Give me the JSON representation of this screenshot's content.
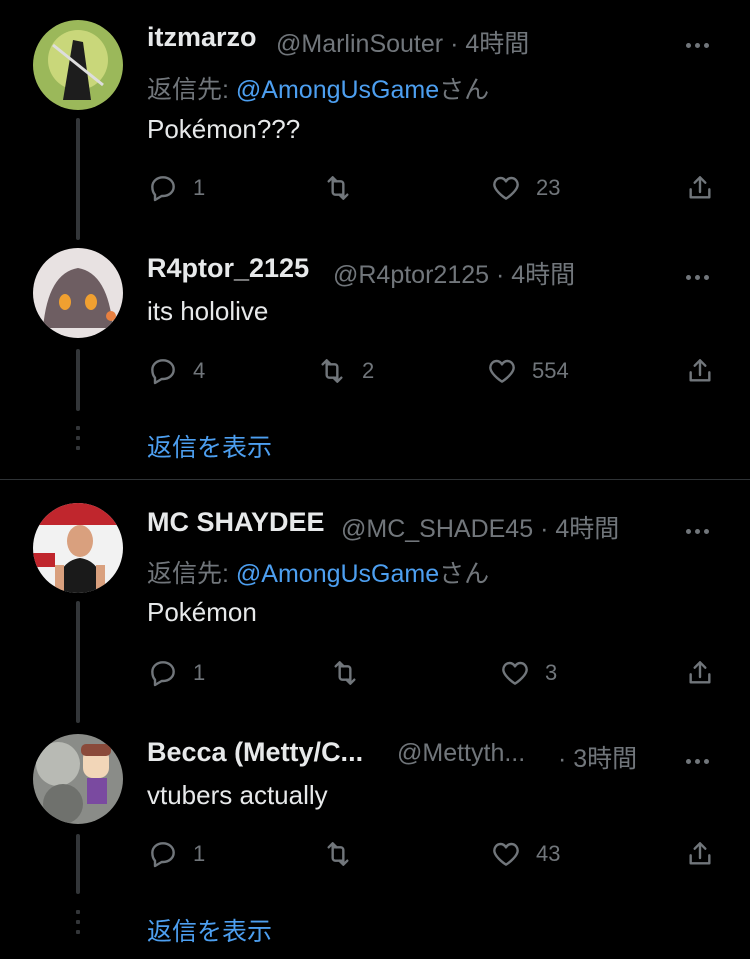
{
  "tweets": [
    {
      "name": "itzmarzo",
      "handle": "@MarlinSouter",
      "time": "· 4時間",
      "reply_prefix": "返信先: ",
      "reply_to": "@AmongUsGame",
      "reply_suffix": "さん",
      "text": "Pokémon???",
      "replies": "1",
      "retweets": "",
      "likes": "23"
    },
    {
      "name": "R4ptor_2125",
      "handle": "@R4ptor2125",
      "time": "· 4時間",
      "text": "its hololive",
      "replies": "4",
      "retweets": "2",
      "likes": "554"
    },
    {
      "name": "MC SHAYDEE",
      "handle": "@MC_SHADE45",
      "time": "· 4時間",
      "reply_prefix": "返信先: ",
      "reply_to": "@AmongUsGame",
      "reply_suffix": "さん",
      "text": "Pokémon",
      "replies": "1",
      "retweets": "",
      "likes": "3"
    },
    {
      "name": "Becca (Metty/C...",
      "handle": "@Mettyth...",
      "time": "· 3時間",
      "text": "vtubers actually",
      "replies": "1",
      "retweets": "",
      "likes": "43"
    }
  ],
  "show_replies_label": "返信を表示",
  "colors": {
    "background": "#000000",
    "link": "#4d9ff0",
    "muted": "#71767b",
    "line": "#333639"
  },
  "icons": [
    "reply-icon",
    "retweet-icon",
    "like-icon",
    "share-icon",
    "more-icon"
  ]
}
